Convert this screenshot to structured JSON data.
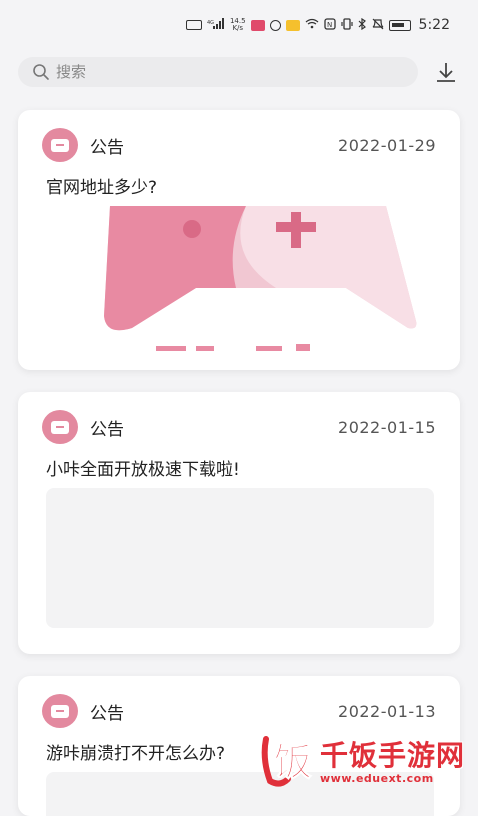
{
  "status_bar": {
    "network": "4G",
    "speed": "14.5\nK/s",
    "time": "5:22",
    "icons": [
      "sim-icon",
      "signal-icon",
      "app-notification-icon",
      "circle-icon",
      "message-icon",
      "wifi-icon",
      "nfc-icon",
      "vibrate-icon",
      "bluetooth-icon",
      "mute-icon",
      "battery-icon"
    ]
  },
  "search": {
    "placeholder": "搜索",
    "value": ""
  },
  "cards": [
    {
      "type": "公告",
      "date": "2022-01-29",
      "title": "官网地址多少?",
      "image": "gamepad-illustration"
    },
    {
      "type": "公告",
      "date": "2022-01-15",
      "title": "小咔全面开放极速下载啦!",
      "image": "placeholder"
    },
    {
      "type": "公告",
      "date": "2022-01-13",
      "title": "游咔崩溃打不开怎么办?",
      "image": "placeholder"
    }
  ],
  "watermark": {
    "logo_char": "饭",
    "title": "千饭手游网",
    "url": "www.eduext.com"
  },
  "colors": {
    "accent_pink": "#e3899f",
    "background": "#f4f4f6",
    "watermark_red": "#e0303a"
  }
}
